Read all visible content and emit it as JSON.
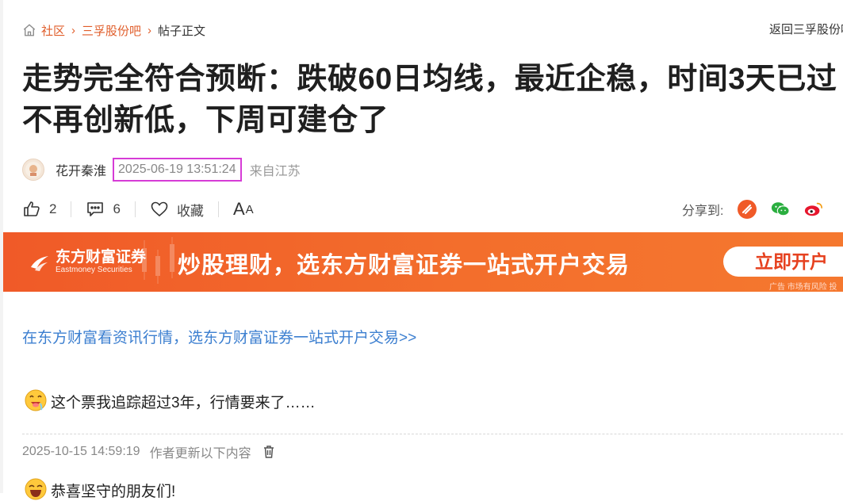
{
  "breadcrumb": {
    "home_label": "社区",
    "bar_label": "三孚股份吧",
    "current_label": "帖子正文"
  },
  "back_link": "返回三孚股份吧",
  "post": {
    "title": "走势完全符合预断：跌破60日均线，最近企稳，时间3天已过不再创新低，下周可建仓了",
    "author": "花开秦淮",
    "time": "2025-06-19 13:51:24",
    "location": "来自江苏"
  },
  "actions": {
    "likes": "2",
    "comments": "6",
    "collect_label": "收藏",
    "font_big": "A",
    "font_small": "A"
  },
  "share": {
    "label": "分享到:",
    "icons": [
      "eastmoney-share-icon",
      "wechat-icon",
      "weibo-icon"
    ]
  },
  "ad": {
    "brand_cn": "东方财富证券",
    "brand_en": "Eastmoney Securities",
    "slogan": "炒股理财，选东方财富证券一站式开户交易",
    "cta": "立即开户",
    "note": "广告 市场有风险 投"
  },
  "content": {
    "promo_link": "在东方财富看资讯行情，选东方财富证券一站式开户交易>>",
    "paragraph1": "这个票我追踪超过3年，行情要来了……",
    "update_time": "2025-10-15 14:59:19",
    "update_label": "作者更新以下内容",
    "paragraph2": "恭喜坚守的朋友们!"
  },
  "colors": {
    "accent": "#e05d2a",
    "link": "#3c7fd0",
    "banner": "#f05a28",
    "highlight_box": "#d63cd6"
  }
}
